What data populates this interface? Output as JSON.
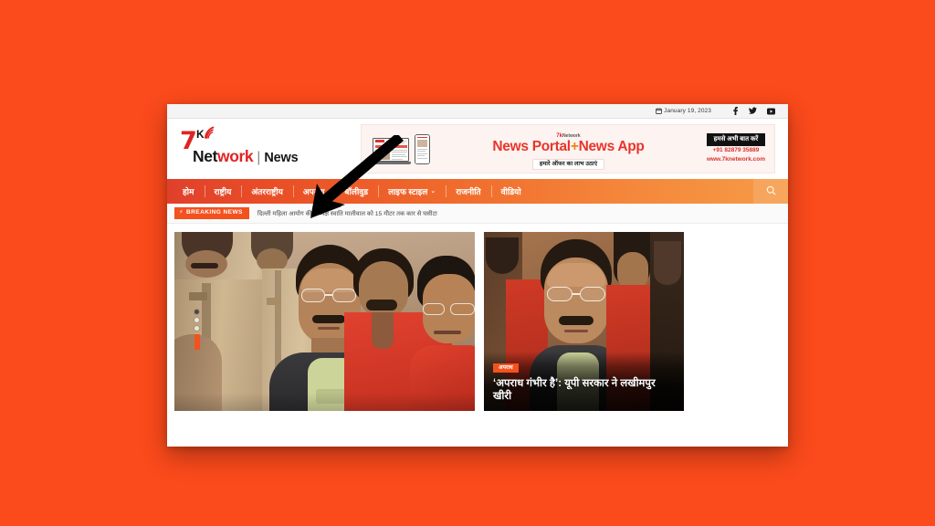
{
  "page": {
    "background_color": "#fb4a1b",
    "annotation": {
      "type": "arrow",
      "direction": "down-left",
      "color": "#000000",
      "points_to": "nav-item-international"
    }
  },
  "topbar": {
    "calendar_icon": "calendar-icon",
    "date": "January 19, 2023",
    "social": [
      {
        "name": "facebook-icon",
        "label": "f"
      },
      {
        "name": "twitter-icon",
        "label": "t"
      },
      {
        "name": "youtube-icon",
        "label": "yt"
      }
    ]
  },
  "logo": {
    "seven": "7",
    "k": "K",
    "signal_icon": "wifi-signal-icon",
    "net": "Net",
    "work": "work",
    "divider": "|",
    "news": "News"
  },
  "banner_ad": {
    "mini_logo": "7k",
    "mini_logo_sub": "Network",
    "headline_left": "News Portal",
    "headline_plus": "+",
    "headline_right": "News App",
    "subtext": "हमारे ऑफर का लाभ उठाएं",
    "cta": "हमसे अभी बात करें",
    "phone": "+91 82879 35889",
    "url": "www.7knetwork.com",
    "device_laptop": "laptop-device",
    "device_phone": "phone-device"
  },
  "nav": {
    "items": [
      {
        "label": "होम",
        "dropdown": false
      },
      {
        "label": "राष्ट्रीय",
        "dropdown": false
      },
      {
        "label": "अंतरराष्ट्रीय",
        "dropdown": false
      },
      {
        "label": "अपराध",
        "dropdown": false
      },
      {
        "label": "बॉलीवुड",
        "dropdown": false
      },
      {
        "label": "लाइफ स्टाइल",
        "dropdown": true,
        "chevron": "⌄"
      },
      {
        "label": "राजनीति",
        "dropdown": false
      },
      {
        "label": "वीडियो",
        "dropdown": false
      }
    ],
    "search_icon": "search-icon",
    "gradient_start": "#e0402b",
    "gradient_end": "#f69b46"
  },
  "breaking": {
    "badge_icon": "⚡",
    "badge_label": "BREAKING NEWS",
    "text": "दिल्ली महिला आयोग की अध्यक्ष स्वाति मालीवाल को 15 मीटर तक कार से घसीटा",
    "badge_color": "#f4511e"
  },
  "content": {
    "hero": {
      "name": "hero-slider",
      "alt": "Man in glasses escorted by police officers in a crowd",
      "carousel_dots": 3,
      "active_index": 3
    },
    "side": {
      "name": "side-article-card",
      "category": "अपराध",
      "title": "‘अपराध गंभीर है’: यूपी सरकार ने लखीमपुर खीरी",
      "alt": "Man in glasses surrounded by people in red shirts"
    }
  }
}
